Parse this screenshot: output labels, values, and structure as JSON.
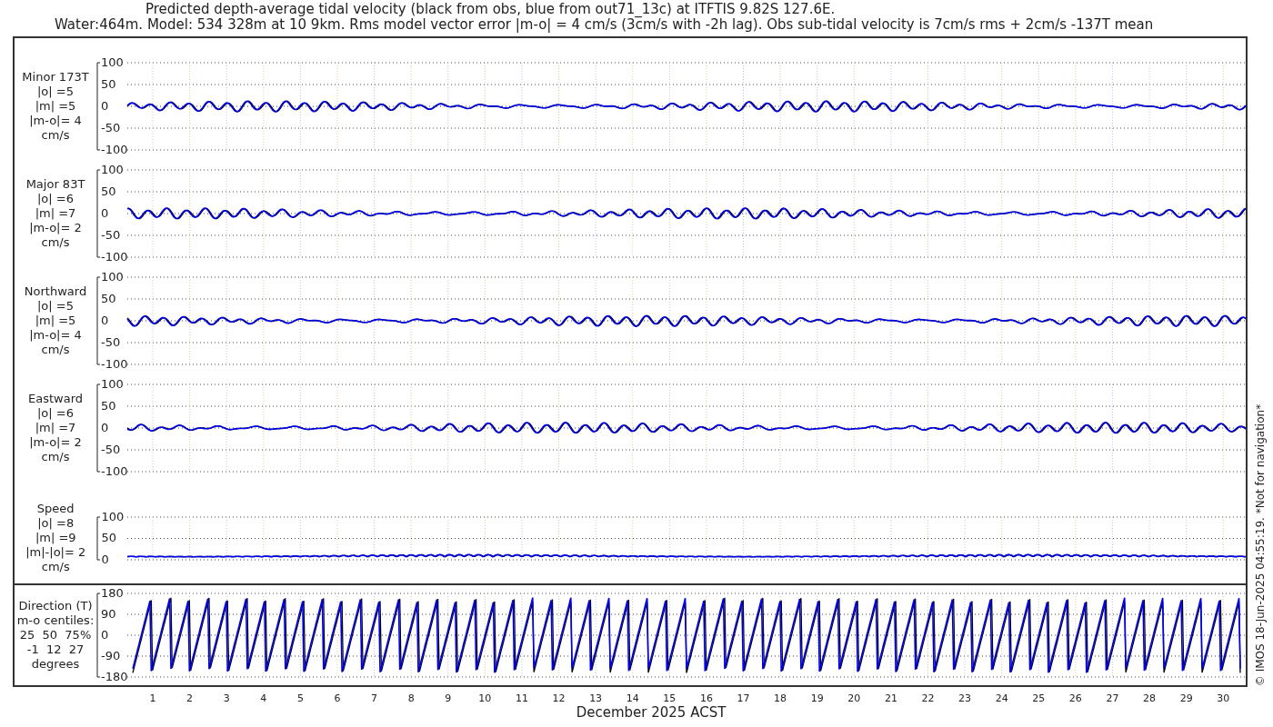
{
  "title": {
    "line_1": "Predicted depth-average tidal velocity (black from obs, blue from out71_13c) at ITFTIS 9.82S 127.6E.",
    "line_2": "Water:464m. Model: 534 328m at 10 9km. Rms model vector error |m-o| = 4 cm/s (3cm/s with -2h lag). Obs sub-tidal velocity is 7cm/s rms + 2cm/s -137T mean"
  },
  "panels": [
    {
      "kind": "signed",
      "label_lines": [
        "Minor 173T",
        "|o| =5",
        "|m| =5",
        "|m-o|= 4",
        "cm/s"
      ],
      "yticks": [
        "100",
        "50",
        "0",
        "-50",
        "-100"
      ]
    },
    {
      "kind": "signed",
      "label_lines": [
        "Major 83T",
        "|o| =6",
        "|m| =7",
        "|m-o|= 2",
        "cm/s"
      ],
      "yticks": [
        "100",
        "50",
        "0",
        "-50",
        "-100"
      ]
    },
    {
      "kind": "signed",
      "label_lines": [
        "Northward",
        "|o| =5",
        "|m| =5",
        "|m-o|= 4",
        "cm/s"
      ],
      "yticks": [
        "100",
        "50",
        "0",
        "-50",
        "-100"
      ]
    },
    {
      "kind": "signed",
      "label_lines": [
        "Eastward",
        "|o| =6",
        "|m| =7",
        "|m-o|= 2",
        "cm/s"
      ],
      "yticks": [
        "100",
        "50",
        "0",
        "-50",
        "-100"
      ]
    },
    {
      "kind": "speed",
      "label_lines": [
        "Speed",
        "|o| =8",
        "|m| =9",
        "|m|-|o|= 2",
        "cm/s"
      ],
      "yticks": [
        "100",
        "50",
        "0"
      ]
    },
    {
      "kind": "direction",
      "label_lines": [
        "Direction (T)",
        "m-o centiles:",
        "25  50  75%",
        "-1  12  27",
        "degrees"
      ],
      "yticks": [
        "180",
        "90",
        "0",
        "-90",
        "-180"
      ]
    }
  ],
  "x_axis": {
    "ticks": [
      "1",
      "2",
      "3",
      "4",
      "5",
      "6",
      "7",
      "8",
      "9",
      "10",
      "11",
      "12",
      "13",
      "14",
      "15",
      "16",
      "17",
      "18",
      "19",
      "20",
      "21",
      "22",
      "23",
      "24",
      "25",
      "26",
      "27",
      "28",
      "29",
      "30"
    ],
    "label": "December 2025 ACST"
  },
  "side_note": "© IMOS 18-Jun-2025 04:55:19. *Not for navigation*"
}
